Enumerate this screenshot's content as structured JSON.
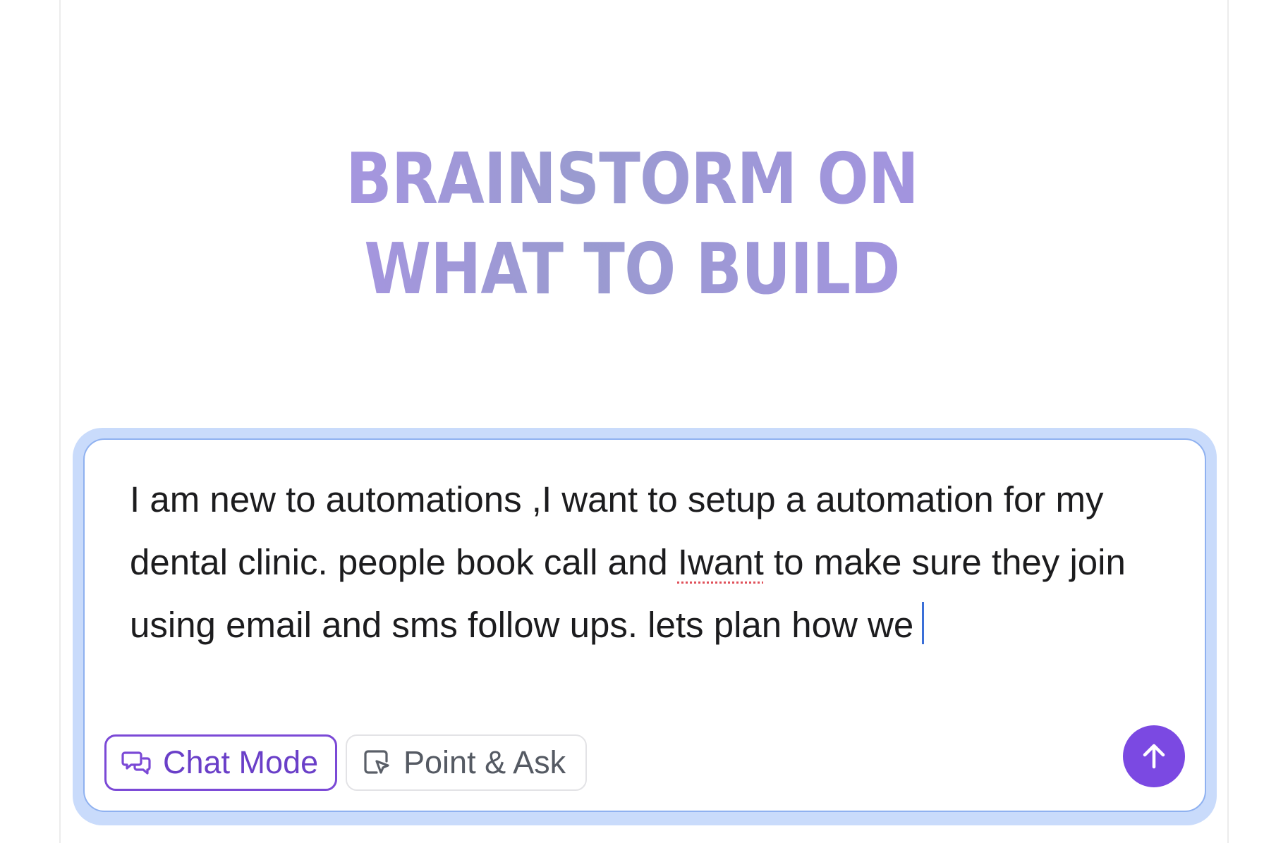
{
  "hero": {
    "line1": "BRAINSTORM ON",
    "line2": "WHAT TO BUILD"
  },
  "composer": {
    "text_part1": "I am new to automations ,I want to setup a automation for my dental clinic. people book call and ",
    "text_misspelled": "Iwant",
    "text_part2": " to make sure they join using email and sms follow ups. lets plan how we"
  },
  "toolbar": {
    "chat_mode_label": "Chat Mode",
    "point_ask_label": "Point & Ask"
  },
  "icons": {
    "chat_mode": "chat-bubbles-icon",
    "point_ask": "pointer-select-icon",
    "send": "arrow-up-icon"
  },
  "colors": {
    "accent": "#7b49e2",
    "focus_ring": "#c9dbfb",
    "focus_border": "#8fb1f0"
  }
}
